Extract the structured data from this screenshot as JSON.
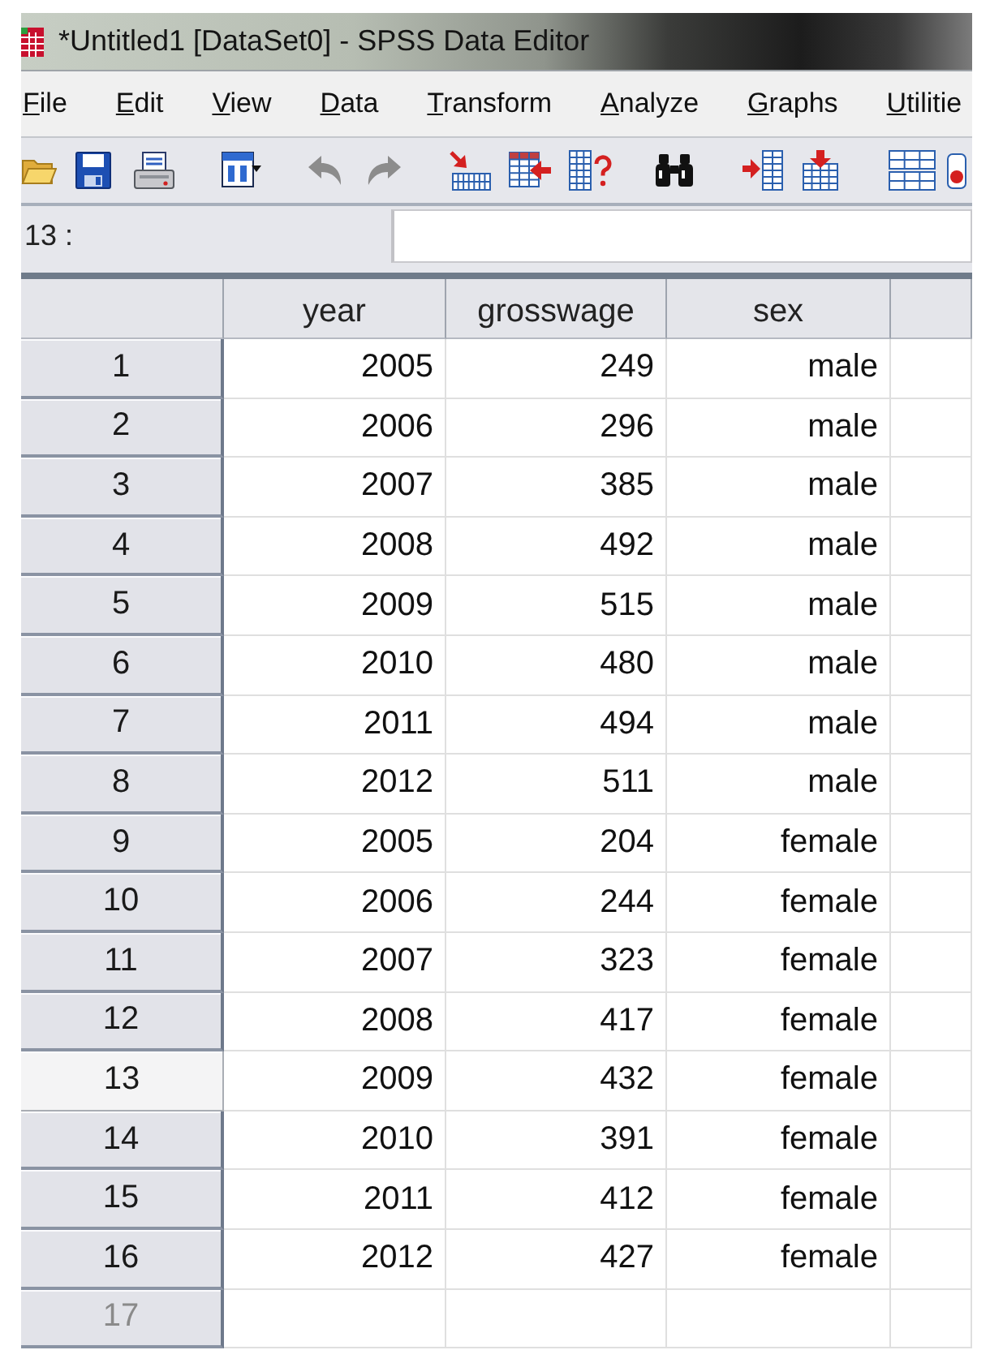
{
  "window": {
    "title": "*Untitled1 [DataSet0] - SPSS Data Editor"
  },
  "menu": [
    "File",
    "Edit",
    "View",
    "Data",
    "Transform",
    "Analyze",
    "Graphs",
    "Utilitie"
  ],
  "toolbar": {
    "undo": {
      "disabled": true
    },
    "redo": {
      "disabled": true
    }
  },
  "cell_editor": {
    "reference": "13 :"
  },
  "table": {
    "columns": [
      "year",
      "grosswage",
      "sex"
    ],
    "rows": [
      {
        "label": "1",
        "selected": false,
        "empty": false,
        "cells": [
          "2005",
          "249",
          "male"
        ]
      },
      {
        "label": "2",
        "selected": false,
        "empty": false,
        "cells": [
          "2006",
          "296",
          "male"
        ]
      },
      {
        "label": "3",
        "selected": false,
        "empty": false,
        "cells": [
          "2007",
          "385",
          "male"
        ]
      },
      {
        "label": "4",
        "selected": false,
        "empty": false,
        "cells": [
          "2008",
          "492",
          "male"
        ]
      },
      {
        "label": "5",
        "selected": false,
        "empty": false,
        "cells": [
          "2009",
          "515",
          "male"
        ]
      },
      {
        "label": "6",
        "selected": false,
        "empty": false,
        "cells": [
          "2010",
          "480",
          "male"
        ]
      },
      {
        "label": "7",
        "selected": false,
        "empty": false,
        "cells": [
          "2011",
          "494",
          "male"
        ]
      },
      {
        "label": "8",
        "selected": false,
        "empty": false,
        "cells": [
          "2012",
          "511",
          "male"
        ]
      },
      {
        "label": "9",
        "selected": false,
        "empty": false,
        "cells": [
          "2005",
          "204",
          "female"
        ]
      },
      {
        "label": "10",
        "selected": false,
        "empty": false,
        "cells": [
          "2006",
          "244",
          "female"
        ]
      },
      {
        "label": "11",
        "selected": false,
        "empty": false,
        "cells": [
          "2007",
          "323",
          "female"
        ]
      },
      {
        "label": "12",
        "selected": false,
        "empty": false,
        "cells": [
          "2008",
          "417",
          "female"
        ]
      },
      {
        "label": "13",
        "selected": true,
        "empty": false,
        "cells": [
          "2009",
          "432",
          "female"
        ]
      },
      {
        "label": "14",
        "selected": false,
        "empty": false,
        "cells": [
          "2010",
          "391",
          "female"
        ]
      },
      {
        "label": "15",
        "selected": false,
        "empty": false,
        "cells": [
          "2011",
          "412",
          "female"
        ]
      },
      {
        "label": "16",
        "selected": false,
        "empty": false,
        "cells": [
          "2012",
          "427",
          "female"
        ]
      },
      {
        "label": "17",
        "selected": false,
        "empty": true
      }
    ]
  }
}
